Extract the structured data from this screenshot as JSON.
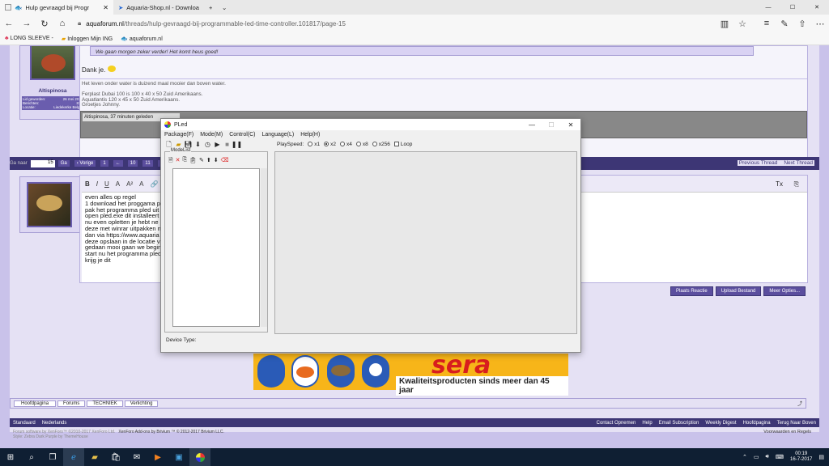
{
  "browser": {
    "tabs": [
      {
        "label": "Hulp gevraagd bij Progr"
      },
      {
        "label": "Aquaria-Shop.nl - Downloa"
      }
    ],
    "new_tab": "+",
    "tab_dropdown": "⌄",
    "url_domain": "aquaforum.nl",
    "url_path": "/threads/hulp-gevraagd-bij-programmable-led-time-controller.101817/page-15",
    "favorites": [
      "LONG SLEEVE -",
      "Inloggen Mijn ING",
      "aquaforum.nl"
    ],
    "window_controls": [
      "—",
      "☐",
      "✕"
    ]
  },
  "post1": {
    "quote": "We gaan morgen zeker verder! Het komt heus goed!",
    "dank": "Dank je.",
    "username": "Altispinosa",
    "meta": [
      [
        "Lid geworden:",
        "26 mei 2011"
      ],
      [
        "Berichten:",
        "816"
      ],
      [
        "Locatie:",
        "Liedekerke België"
      ]
    ],
    "signature": [
      "Het leven onder water is duizend maal mooier dan boven water.",
      "",
      "Ferplast Dubai 100 is 100 x 40 x 50 Zuid Amerikaans.",
      "Aquatlantis 120 x 45 x 50 Zuid Amerikaans.",
      "Groetjes Johnny."
    ],
    "last_seen": "Altispinosa, 37 minuten geleden"
  },
  "pagination": {
    "label": "Ga naar",
    "input": "15",
    "go": "Ga",
    "items": [
      "‹ Vorige",
      "1",
      "←",
      "10",
      "11",
      "12"
    ],
    "prev_thread": "Previous Thread",
    "next_thread": "Next Thread"
  },
  "editor": {
    "tools": [
      "B",
      "I",
      "U",
      "A",
      "A²",
      "A",
      "🔗"
    ],
    "lines": [
      "even alles op regel",
      "1 download het proggama p",
      "pak het programma pled uit",
      "open pled.exe dit installeert",
      "nu even opletten  je hebt ne",
      "deze met winrar uitpakken n",
      "dan via https://www.aquaria",
      "deze opslaan in de locatie v",
      "gedaan mooi gaan we begin",
      "start nu het programma pled",
      "krijg je dit"
    ],
    "buttons": [
      "Plaats Reactie",
      "Upload Bestand",
      "Meer Opties..."
    ]
  },
  "pled": {
    "title": "PLed",
    "menu": [
      "Package(F)",
      "Mode(M)",
      "Control(C)",
      "Language(L)",
      "Help(H)"
    ],
    "playspeed_label": "PlaySpeed:",
    "speeds": [
      {
        "label": "x1",
        "selected": false
      },
      {
        "label": "x2",
        "selected": true
      },
      {
        "label": "x4",
        "selected": false
      },
      {
        "label": "x8",
        "selected": false
      },
      {
        "label": "x256",
        "selected": false
      }
    ],
    "loop_label": "Loop",
    "modelist_label": "ModeList",
    "device_type_label": "Device Type:"
  },
  "ad": {
    "brand": "sera",
    "slogan": "Kwaliteitsproducten sinds meer dan 45 jaar",
    "can_labels": [
      "sera vipan",
      "sera vipagran",
      "",
      "sera flora"
    ]
  },
  "breadcrumbs": [
    "Hoofdpagina",
    "Forums",
    "TECHNIEK",
    "Verlichting"
  ],
  "footer": {
    "left": [
      "Standaard",
      "Nederlands"
    ],
    "right": [
      "Contact Opnemen",
      "Help",
      "Email Subscription",
      "Weekly Digest",
      "Hoofdpagina",
      "Terug Naar Boven"
    ],
    "copyright1": "Forum software by XenForo™ ©2010-2017 XenForo Ltd.",
    "copyright2": "XenForo Add-ons by Brivium ™ © 2012-2017 Brivium LLC.",
    "copyright3": "Style: Zebra Dark Purple by ThemeHouse",
    "terms": "Voorwaarden en Regels"
  },
  "taskbar": {
    "time": "00:19",
    "date": "16-7-2017"
  },
  "colors": {
    "accent": "#5b4e9e",
    "dark_bar": "#3d3675",
    "page_bg": "#c9c2ea",
    "taskbar": "#0f1f33",
    "sera_yellow": "#f7b519",
    "sera_red": "#d81e1e"
  }
}
